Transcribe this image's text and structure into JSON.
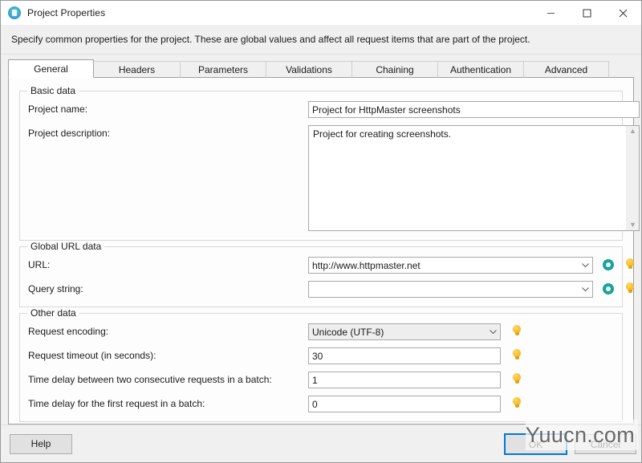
{
  "window": {
    "title": "Project Properties",
    "icon": "app-icon",
    "controls": {
      "minimize": "minimize",
      "maximize": "maximize",
      "close": "close"
    }
  },
  "instruction": "Specify common properties for the project. These are global values and affect all request items that are part of the project.",
  "tabs": [
    {
      "label": "General",
      "active": true
    },
    {
      "label": "Headers",
      "active": false
    },
    {
      "label": "Parameters",
      "active": false
    },
    {
      "label": "Validations",
      "active": false
    },
    {
      "label": "Chaining",
      "active": false
    },
    {
      "label": "Authentication",
      "active": false
    },
    {
      "label": "Advanced",
      "active": false
    }
  ],
  "groups": {
    "basic": {
      "title": "Basic data",
      "project_name": {
        "label": "Project name:",
        "value": "Project for HttpMaster screenshots"
      },
      "project_description": {
        "label": "Project description:",
        "value": "Project for creating screenshots."
      }
    },
    "global_url": {
      "title": "Global URL data",
      "url": {
        "label": "URL:",
        "value": "http://www.httpmaster.net"
      },
      "query_string": {
        "label": "Query string:",
        "value": ""
      }
    },
    "other": {
      "title": "Other data",
      "encoding": {
        "label": "Request encoding:",
        "value": "Unicode (UTF-8)"
      },
      "timeout": {
        "label": "Request timeout (in seconds):",
        "value": "30"
      },
      "delay_between": {
        "label": "Time delay between two consecutive requests in a batch:",
        "value": "1"
      },
      "delay_first": {
        "label": "Time delay for the first request in a batch:",
        "value": "0"
      }
    }
  },
  "buttons": {
    "help": "Help",
    "ok": "OK",
    "cancel": "Cancel"
  },
  "watermark": "Yuucn.com",
  "colors": {
    "accent_teal": "#17a2a2",
    "bulb_yellow": "#f5b824",
    "focus_blue": "#0078d7",
    "dialog_bg": "#f0f0f0",
    "page_bg": "#fdfdfd"
  }
}
